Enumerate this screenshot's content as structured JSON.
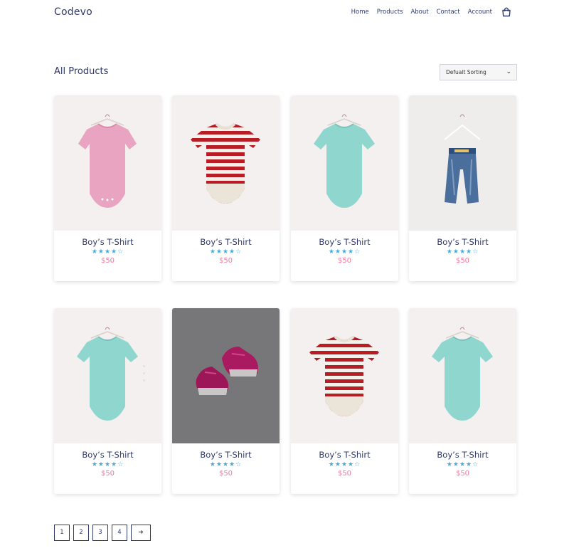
{
  "header": {
    "logo": "Codevo",
    "nav": [
      "Home",
      "Products",
      "About",
      "Contact",
      "Account"
    ]
  },
  "main": {
    "title": "All Products",
    "sort": {
      "selected": "Defualt Sorting"
    }
  },
  "products": [
    {
      "name": "Boy’s T-Shirt",
      "stars": "★★★★☆",
      "price": "$50",
      "image": "pink-bodysuit"
    },
    {
      "name": "Boy’s T-Shirt",
      "stars": "★★★★☆",
      "price": "$50",
      "image": "striped-bodysuit"
    },
    {
      "name": "Boy’s T-Shirt",
      "stars": "★★★★☆",
      "price": "$50",
      "image": "mint-bodysuit"
    },
    {
      "name": "Boy’s T-Shirt",
      "stars": "★★★★☆",
      "price": "$50",
      "image": "denim-jeans"
    },
    {
      "name": "Boy’s T-Shirt",
      "stars": "★★★★☆",
      "price": "$50",
      "image": "mint-bodysuit"
    },
    {
      "name": "Boy’s T-Shirt",
      "stars": "★★★★☆",
      "price": "$50",
      "image": "pink-sneakers"
    },
    {
      "name": "Boy’s T-Shirt",
      "stars": "★★★★☆",
      "price": "$50",
      "image": "striped-bodysuit"
    },
    {
      "name": "Boy’s T-Shirt",
      "stars": "★★★★☆",
      "price": "$50",
      "image": "mint-bodysuit"
    }
  ],
  "pagination": {
    "pages": [
      "1",
      "2",
      "3",
      "4"
    ],
    "next": "➔"
  },
  "colors": {
    "primary": "#2f3a6b",
    "star": "#49a9d9",
    "price": "#f27aa0"
  }
}
